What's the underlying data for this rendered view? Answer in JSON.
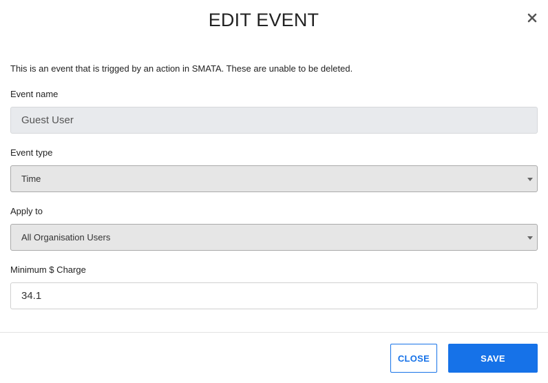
{
  "modal": {
    "title": "EDIT EVENT",
    "close_icon": "close-icon",
    "info_text": "This is an event that is trigged by an action in SMATA. These are unable to be deleted."
  },
  "form": {
    "event_name": {
      "label": "Event name",
      "value": "Guest User"
    },
    "event_type": {
      "label": "Event type",
      "value": "Time"
    },
    "apply_to": {
      "label": "Apply to",
      "value": "All Organisation Users"
    },
    "minimum_charge": {
      "label": "Minimum $ Charge",
      "value": "34.1"
    }
  },
  "footer": {
    "close_label": "CLOSE",
    "save_label": "SAVE"
  },
  "colors": {
    "accent": "#1672e8",
    "disabled_bg": "#e8eaed",
    "select_bg": "#e6e6e6"
  }
}
